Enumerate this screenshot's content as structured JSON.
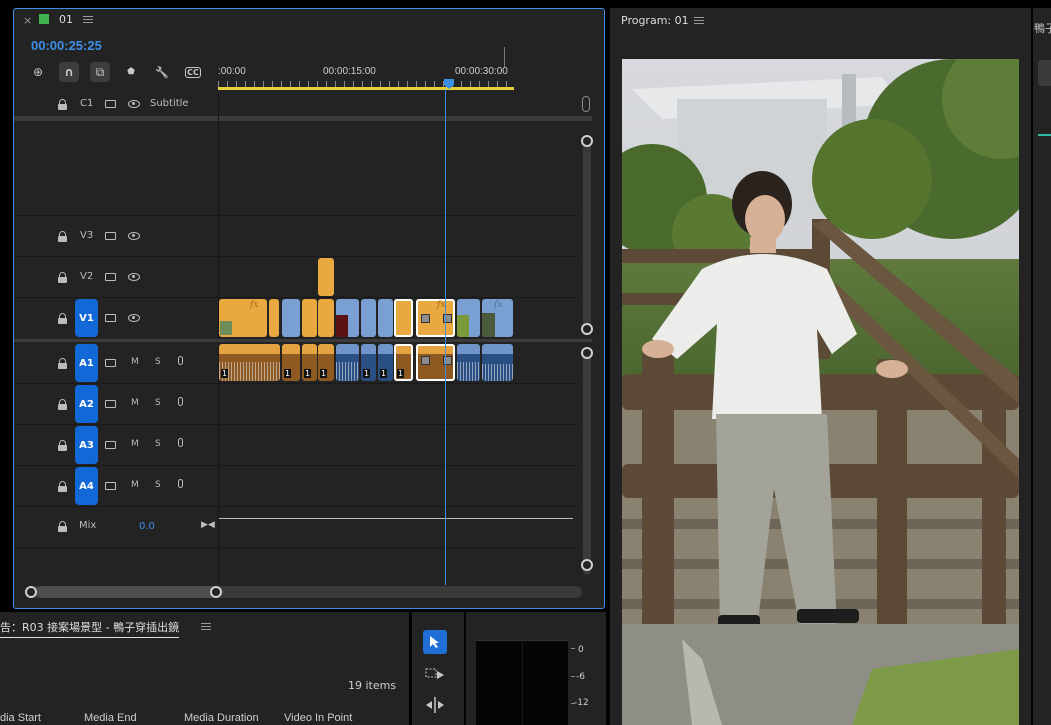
{
  "timeline": {
    "close_glyph": "×",
    "sequence_name": "01",
    "timecode": "00:00:25:25",
    "ruler": [
      ":00:00",
      "00:00:15:00",
      "00:00:30:00"
    ],
    "tools": [
      {
        "name": "insert-sequence-icon",
        "glyph": "⊕"
      },
      {
        "name": "snap-icon",
        "glyph": "∩"
      },
      {
        "name": "linked-selection-icon",
        "glyph": "⧉"
      },
      {
        "name": "marker-icon",
        "glyph": "⬟"
      },
      {
        "name": "wrench-icon",
        "glyph": "🔧"
      },
      {
        "name": "captions-icon",
        "glyph": "CC"
      }
    ],
    "caption_track": {
      "label": "C1",
      "name": "Subtitle"
    },
    "video_tracks": [
      "V3",
      "V2",
      "V1"
    ],
    "audio_tracks": [
      "A1",
      "A2",
      "A3",
      "A4"
    ],
    "mute_label": "M",
    "solo_label": "S",
    "mix": {
      "label": "Mix",
      "value": "0.0"
    },
    "fx_label": "fx",
    "channel_label": "1"
  },
  "program": {
    "title": "Program: 01"
  },
  "project": {
    "title": "告：R03 接案場景型 - 鴨子穿插出鏡",
    "item_count": "19 items",
    "columns": [
      "dia Start",
      "Media End",
      "Media Duration",
      "Video In Point"
    ]
  },
  "meter": {
    "scale": [
      "0",
      "-6",
      "-12"
    ]
  },
  "right_panel": {
    "title_fragment": "鴨子"
  },
  "colors": {
    "accent": "#3a8ee6",
    "track_target": "#1268d6",
    "video_clip_orange": "#eaa840",
    "video_clip_blue": "#7a9fd2",
    "playhead": "#3c8fe6"
  }
}
